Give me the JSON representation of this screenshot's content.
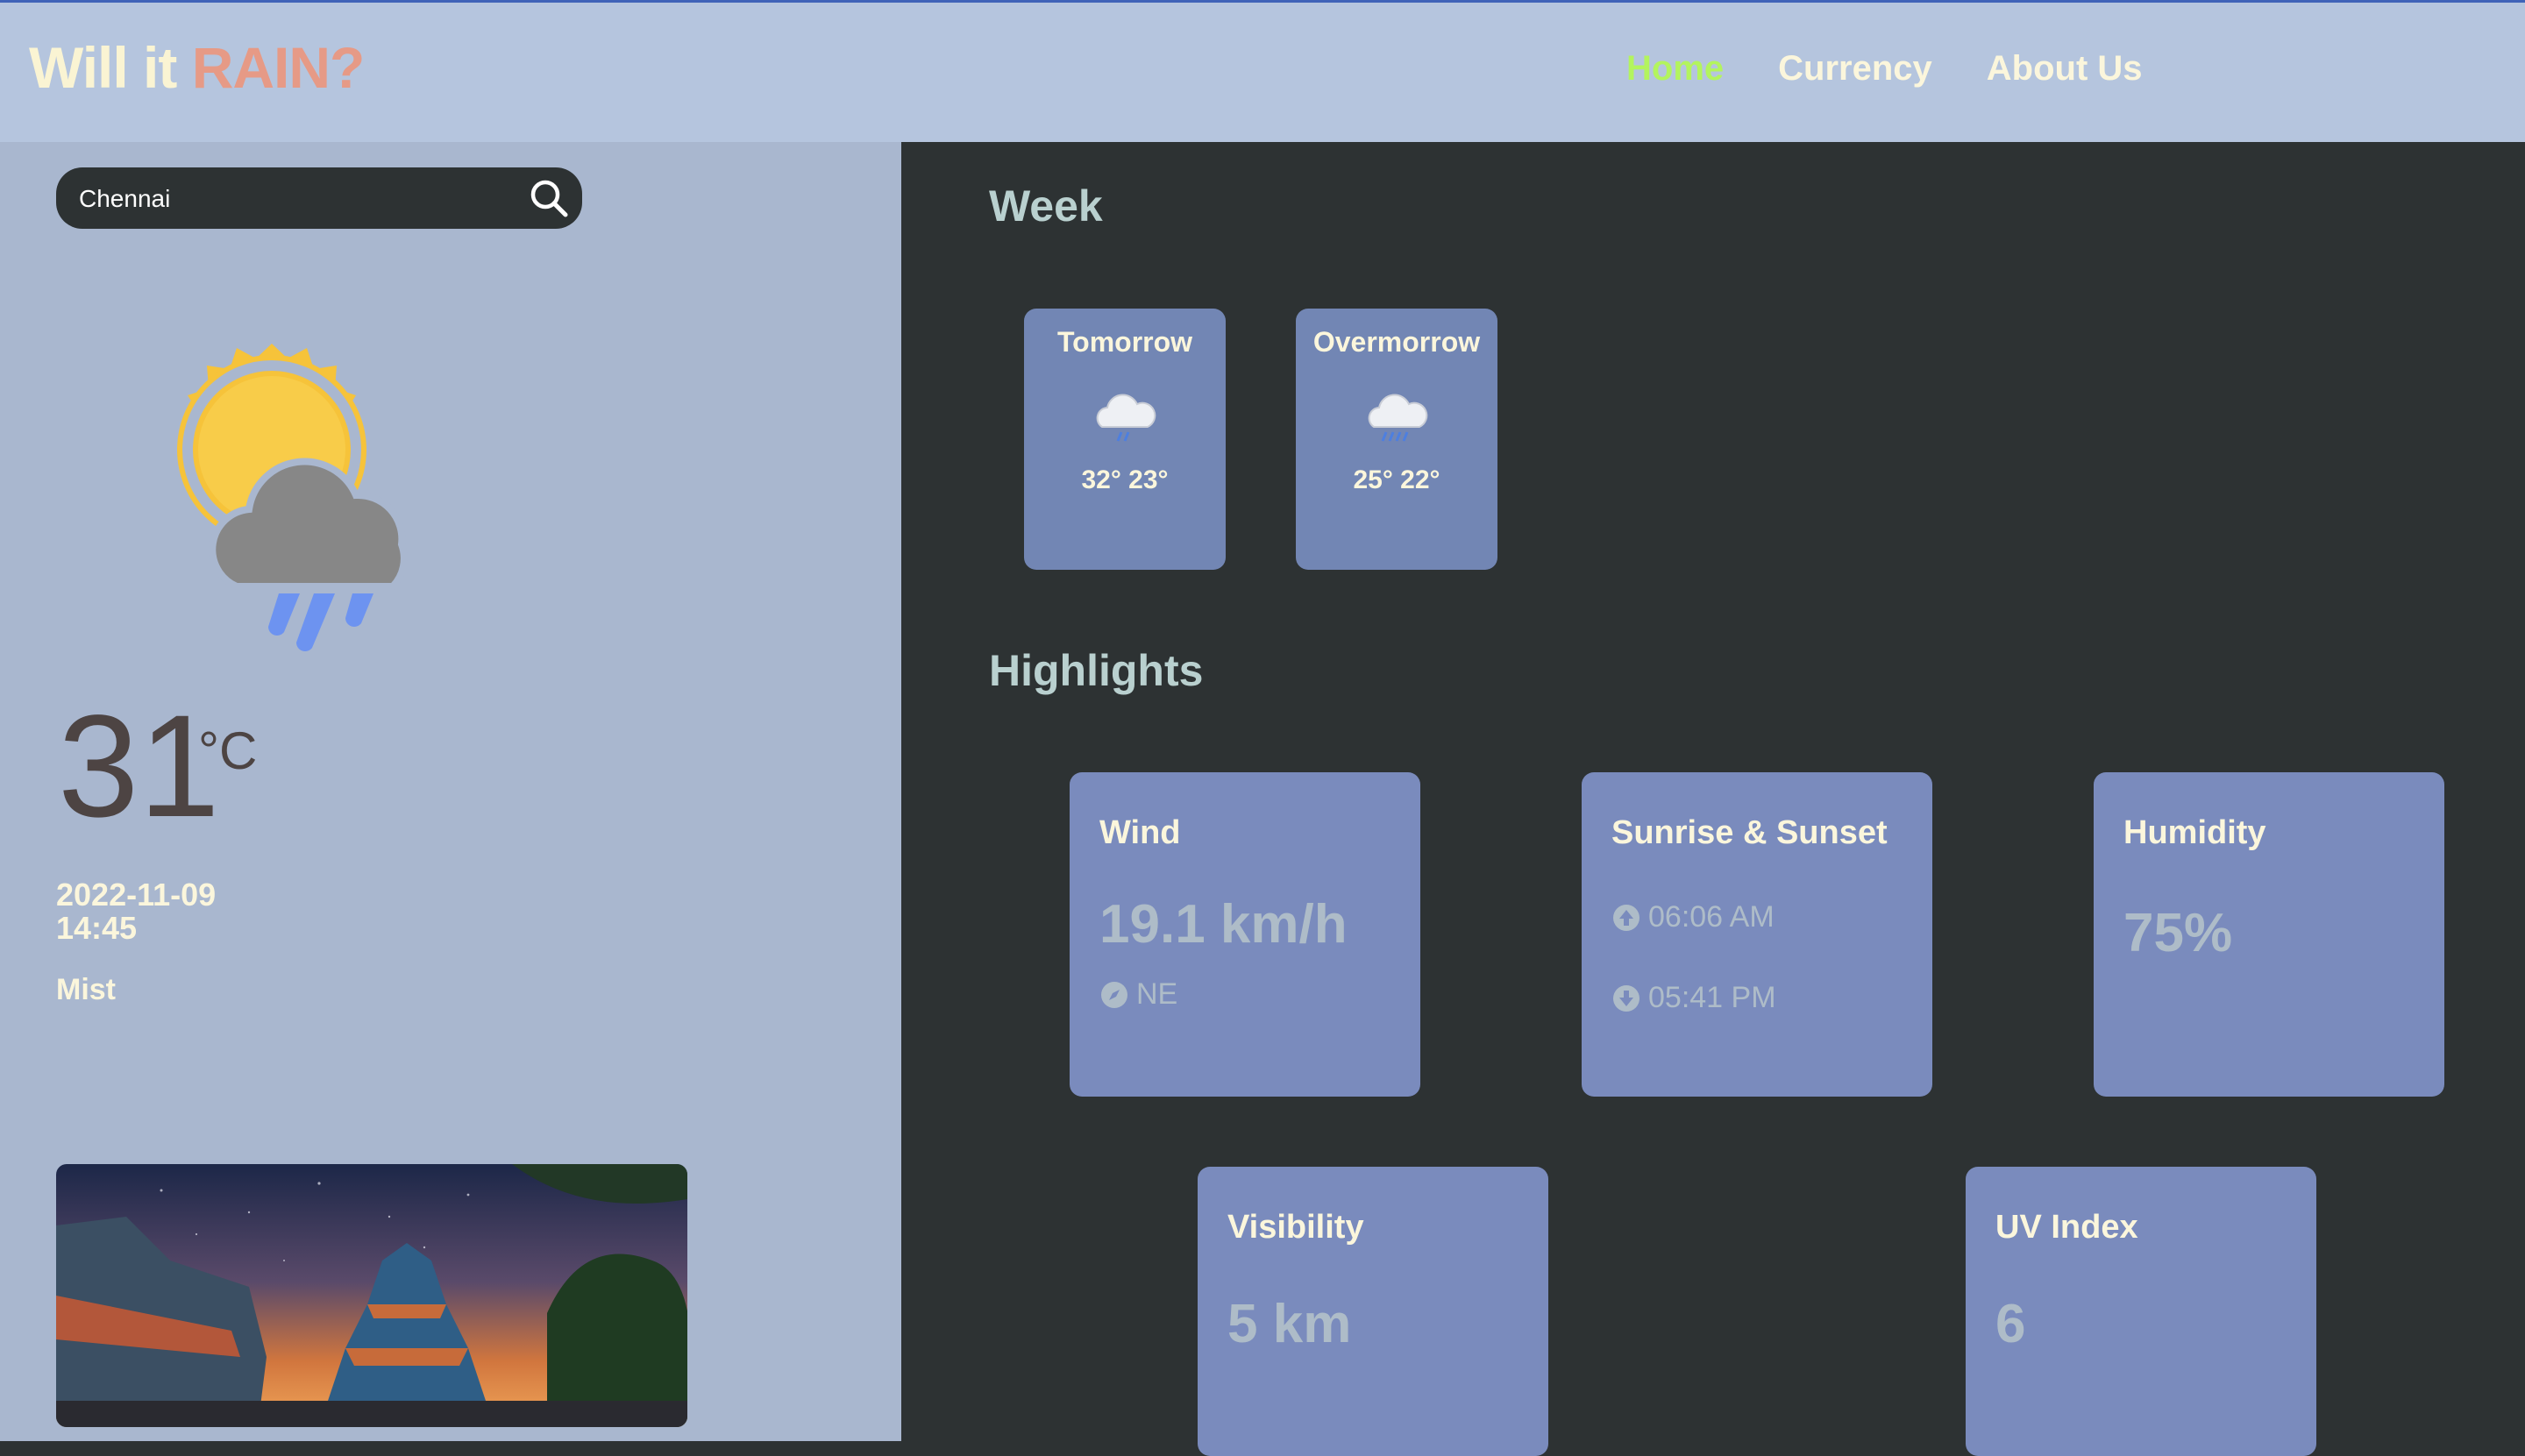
{
  "header": {
    "logo_part1": "Will it ",
    "logo_part2": "RAIN?",
    "nav": [
      {
        "label": "Home",
        "active": true
      },
      {
        "label": "Currency",
        "active": false
      },
      {
        "label": "About Us",
        "active": false
      }
    ]
  },
  "sidebar": {
    "search_value": "Chennai",
    "search_icon": "search-icon",
    "weather_icon": "sun-cloud-rain-icon",
    "temperature": "31",
    "unit": "°C",
    "date": "2022-11-09",
    "time": "14:45",
    "condition": "Mist"
  },
  "main": {
    "week_title": "Week",
    "days": [
      {
        "name": "Tomorrow",
        "range": "32° 23°",
        "icon": "light-rain-cloud-icon"
      },
      {
        "name": "Overmorrow",
        "range": "25° 22°",
        "icon": "rain-cloud-icon"
      }
    ],
    "highlights_title": "Highlights",
    "highlights": {
      "wind": {
        "title": "Wind",
        "value": "19.1 km/h",
        "direction": "NE"
      },
      "sun": {
        "title": "Sunrise & Sunset",
        "sunrise": "06:06 AM",
        "sunset": "05:41 PM"
      },
      "humidity": {
        "title": "Humidity",
        "value": "75%"
      },
      "visibility": {
        "title": "Visibility",
        "value": "5 km"
      },
      "uv": {
        "title": "UV Index",
        "value": "6"
      }
    }
  },
  "colors": {
    "header_bg": "#b5c5de",
    "sidebar_bg": "#a9b7cf",
    "main_bg": "#2d3233",
    "nav_active": "#b3f45e",
    "logo_accent": "#e69a86",
    "card_bg": "#7a8bbd"
  }
}
